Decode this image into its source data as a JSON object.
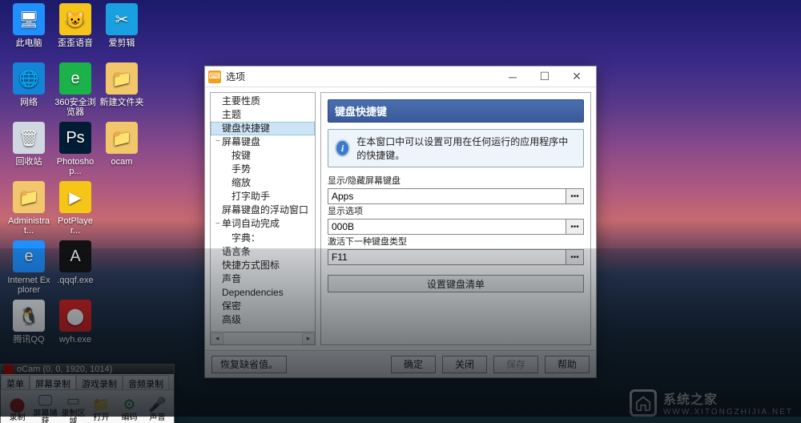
{
  "desktop_icons": [
    {
      "label": "此电脑",
      "col": 0,
      "row": 0,
      "bg": "#1e90ff",
      "glyph": "🖥"
    },
    {
      "label": "歪歪语音",
      "col": 1,
      "row": 0,
      "bg": "#f5c518",
      "glyph": "😺"
    },
    {
      "label": "爱剪辑",
      "col": 2,
      "row": 0,
      "bg": "#1aa0e0",
      "glyph": "✂"
    },
    {
      "label": "网络",
      "col": 0,
      "row": 1,
      "bg": "#1583d6",
      "glyph": "🌐"
    },
    {
      "label": "360安全浏览器",
      "col": 1,
      "row": 1,
      "bg": "#1cb24a",
      "glyph": "e"
    },
    {
      "label": "新建文件夹",
      "col": 2,
      "row": 1,
      "bg": "#f2c76b",
      "glyph": "📁"
    },
    {
      "label": "回收站",
      "col": 0,
      "row": 2,
      "bg": "#cfd8e0",
      "glyph": "🗑"
    },
    {
      "label": "Photoshop...",
      "col": 1,
      "row": 2,
      "bg": "#001d34",
      "glyph": "Ps"
    },
    {
      "label": "ocam",
      "col": 2,
      "row": 2,
      "bg": "#f2c76b",
      "glyph": "📁"
    },
    {
      "label": "Administrat...",
      "col": 0,
      "row": 3,
      "bg": "#f2c76b",
      "glyph": "📁"
    },
    {
      "label": "PotPlayer...",
      "col": 1,
      "row": 3,
      "bg": "#f5c518",
      "glyph": "▶"
    },
    {
      "label": "Internet Explorer",
      "col": 0,
      "row": 4,
      "bg": "#1e90ff",
      "glyph": "e"
    },
    {
      "label": ".qqqf.exe",
      "col": 1,
      "row": 4,
      "bg": "#111",
      "glyph": "A"
    },
    {
      "label": "腾讯QQ",
      "col": 0,
      "row": 5,
      "bg": "#ffffff",
      "glyph": "🐧"
    },
    {
      "label": "wyh.exe",
      "col": 1,
      "row": 5,
      "bg": "#e02020",
      "glyph": "⬤"
    }
  ],
  "dialog": {
    "title": "选项",
    "tree": [
      {
        "label": "主要性质",
        "depth": 0,
        "exp": ""
      },
      {
        "label": "主题",
        "depth": 0,
        "exp": ""
      },
      {
        "label": "键盘快捷键",
        "depth": 0,
        "exp": "",
        "sel": true
      },
      {
        "label": "屏幕键盘",
        "depth": 0,
        "exp": "−"
      },
      {
        "label": "按键",
        "depth": 1,
        "exp": ""
      },
      {
        "label": "手势",
        "depth": 1,
        "exp": ""
      },
      {
        "label": "缩放",
        "depth": 1,
        "exp": ""
      },
      {
        "label": "打字助手",
        "depth": 1,
        "exp": ""
      },
      {
        "label": "屏幕键盘的浮动窗口",
        "depth": 0,
        "exp": ""
      },
      {
        "label": "单词自动完成",
        "depth": 0,
        "exp": "−"
      },
      {
        "label": "字典：",
        "depth": 1,
        "exp": ""
      },
      {
        "label": "语言条",
        "depth": 0,
        "exp": ""
      },
      {
        "label": "快捷方式图标",
        "depth": 0,
        "exp": ""
      },
      {
        "label": "声音",
        "depth": 0,
        "exp": ""
      },
      {
        "label": "Dependencies",
        "depth": 0,
        "exp": ""
      },
      {
        "label": "保密",
        "depth": 0,
        "exp": ""
      },
      {
        "label": "高级",
        "depth": 0,
        "exp": ""
      }
    ],
    "panel": {
      "title": "键盘快捷键",
      "info": "在本窗口中可以设置可用在任何运行的应用程序中的快捷键。",
      "fields": [
        {
          "label": "显示/隐藏屏幕键盘",
          "value": "Apps"
        },
        {
          "label": "显示选项",
          "value": "000B"
        },
        {
          "label": "激活下一种键盘类型",
          "value": "F11"
        }
      ],
      "config_btn": "设置键盘清单"
    },
    "footer": {
      "restore": "恢复缺省值。",
      "ok": "确定",
      "close": "关闭",
      "save": "保存",
      "help": "帮助"
    }
  },
  "ocam": {
    "title": "oCam (0, 0, 1920, 1014)",
    "tabs": [
      "菜单",
      "屏幕录制",
      "游戏录制",
      "音频录制"
    ],
    "active_tab": 1,
    "tools": [
      {
        "label": "录制",
        "glyph": "⬤",
        "color": "#d02020"
      },
      {
        "label": "屏幕捕获",
        "glyph": "🖵",
        "color": "#1e70d0"
      },
      {
        "label": "录制区域",
        "glyph": "▭",
        "color": "#2a9a4a"
      },
      {
        "label": "打开",
        "glyph": "📁",
        "color": "#e0a020"
      },
      {
        "label": "编码",
        "glyph": "⚙",
        "color": "#2a9a4a"
      },
      {
        "label": "声音",
        "glyph": "🎤",
        "color": "#8aa020"
      }
    ]
  },
  "watermark": {
    "title": "系统之家",
    "sub": "WWW.XITONGZHIJIA.NET"
  }
}
